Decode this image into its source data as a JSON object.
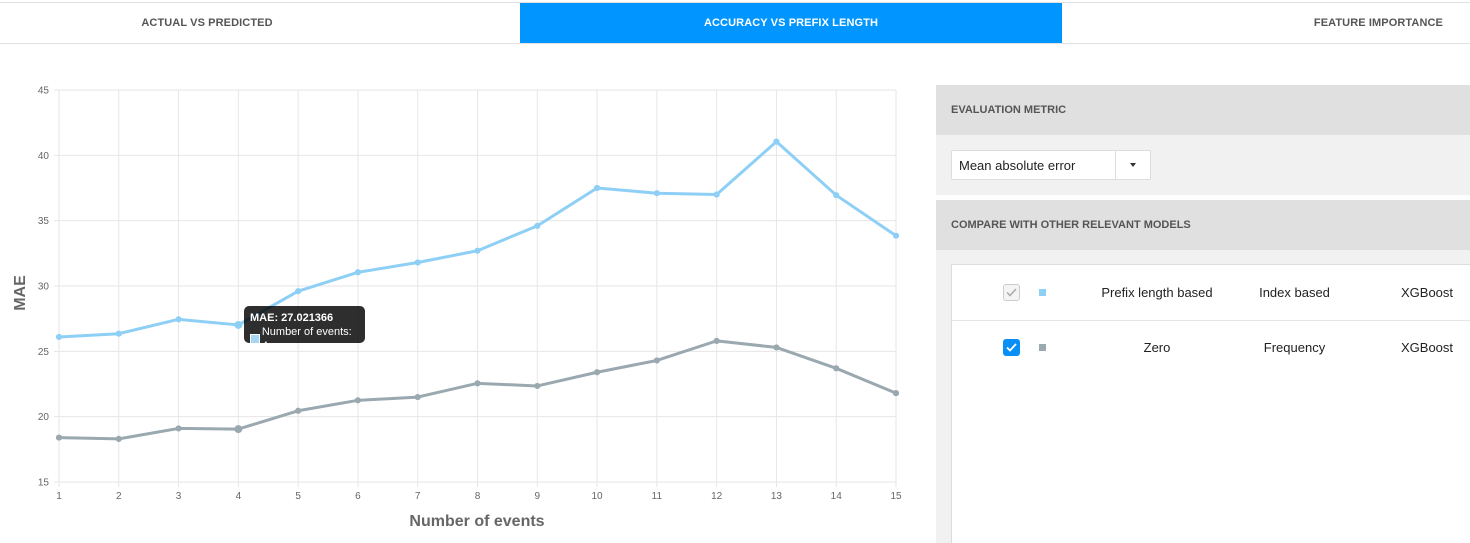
{
  "tabs": [
    {
      "label": "ACTUAL VS PREDICTED"
    },
    {
      "label": "ACCURACY VS PREFIX LENGTH"
    },
    {
      "label": "FEATURE IMPORTANCE"
    }
  ],
  "chart_data": {
    "type": "line",
    "title": "",
    "xlabel": "Number of events",
    "ylabel": "MAE",
    "x": [
      1,
      2,
      3,
      4,
      5,
      6,
      7,
      8,
      9,
      10,
      11,
      12,
      13,
      14,
      15
    ],
    "ylim": [
      15,
      45
    ],
    "yticks": [
      15,
      20,
      25,
      30,
      35,
      40,
      45
    ],
    "grid": true,
    "series": [
      {
        "color": "#8ecff5",
        "values": [
          26.1,
          26.35,
          27.45,
          27.02,
          29.6,
          31.05,
          31.8,
          32.7,
          34.6,
          37.5,
          37.1,
          37.0,
          41.05,
          36.95,
          33.85
        ]
      },
      {
        "color": "#9aa8b0",
        "values": [
          18.4,
          18.3,
          19.1,
          19.05,
          20.45,
          21.25,
          21.5,
          22.55,
          22.35,
          23.4,
          24.3,
          25.8,
          25.3,
          23.7,
          21.8
        ]
      }
    ]
  },
  "tooltip": {
    "title": "MAE: 27.021366",
    "label": "Number of events: 4"
  },
  "metric_panel": {
    "header": "EVALUATION METRIC",
    "selected": "Mean absolute error"
  },
  "compare_panel": {
    "header": "COMPARE WITH OTHER RELEVANT MODELS",
    "rows": [
      {
        "encoding": "Prefix length based",
        "labeling": "Index based",
        "classifier": "XGBoost",
        "color": "#8ecff5"
      },
      {
        "encoding": "Zero",
        "labeling": "Frequency",
        "classifier": "XGBoost",
        "color": "#9aa8b0"
      }
    ]
  }
}
